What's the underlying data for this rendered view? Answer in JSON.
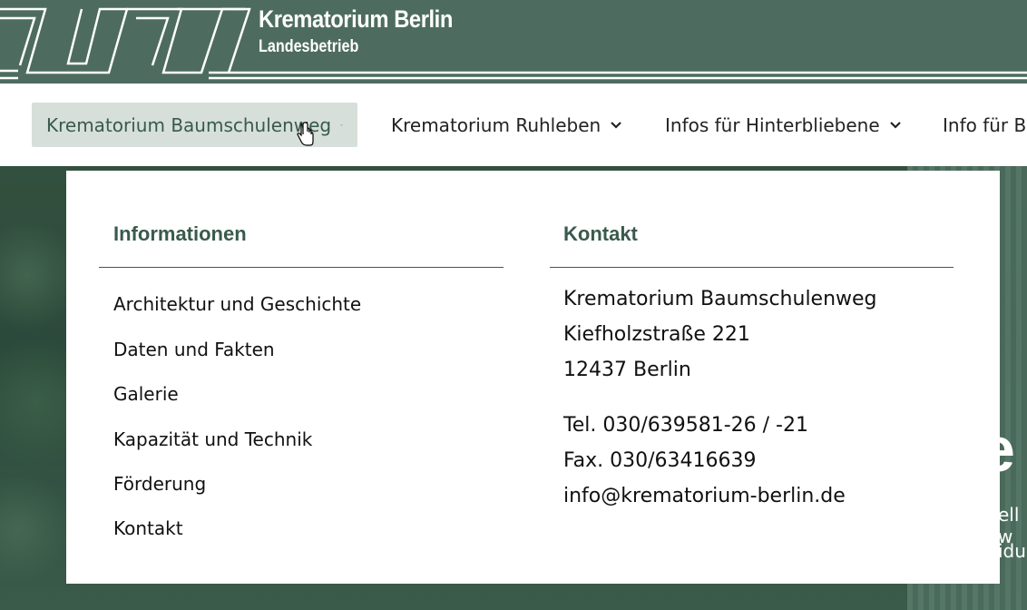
{
  "brand": {
    "title": "Krematorium Berlin",
    "subtitle": "Landesbetrieb"
  },
  "nav": {
    "items": [
      {
        "label": "Krematorium Baumschulenweg",
        "active": true
      },
      {
        "label": "Krematorium Ruhleben",
        "active": false
      },
      {
        "label": "Infos für Hinterbliebene",
        "active": false
      },
      {
        "label": "Info für Be",
        "active": false
      }
    ]
  },
  "dropdown": {
    "info_heading": "Informationen",
    "info_links": [
      "Architektur und Geschichte",
      "Daten und Fakten",
      "Galerie",
      "Kapazität und Technik",
      "Förderung",
      "Kontakt"
    ],
    "contact_heading": "Kontakt",
    "contact_address": [
      "Krematorium Baumschulenweg",
      "Kiefholzstraße 221",
      "12437 Berlin"
    ],
    "contact_phone": "Tel. 030/639581-26 / -21",
    "contact_fax": "Fax. 030/63416639",
    "contact_email": "info@krematorium-berlin.de"
  },
  "hero": {
    "headline_fragment": "e",
    "line1_fragment": "ell w",
    "line2_fragment": "idu"
  },
  "colors": {
    "header_bg": "#4d6c5f",
    "accent": "#395a4c",
    "active_nav_bg": "#d6dfda"
  }
}
